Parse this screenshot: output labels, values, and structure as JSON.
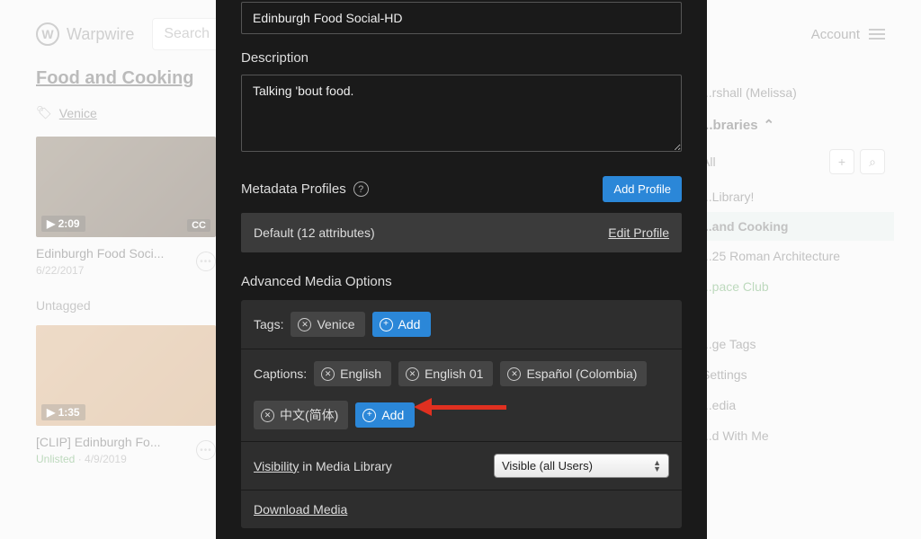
{
  "header": {
    "brand": "Warpwire",
    "search_placeholder": "Search",
    "account": "Account"
  },
  "library": {
    "title": "Food and Cooking",
    "tag": "Venice",
    "untagged_label": "Untagged",
    "cards": [
      {
        "duration": "▶ 2:09",
        "cc": "CC",
        "title": "Edinburgh Food Soci...",
        "date": "6/22/2017"
      },
      {
        "duration": "▶ 1:35",
        "title": "[CLIP] Edinburgh Fo...",
        "status": "Unlisted",
        "date": "4/9/2019"
      }
    ]
  },
  "sidebar": {
    "owner": "...rshall (Melissa)",
    "libraries_header": "...braries",
    "items": {
      "all": "All",
      "mylib": "...Library!",
      "active": "...and Cooking",
      "arch": "...25 Roman Architecture",
      "club": "...pace Club",
      "tags": "...ge Tags",
      "settings": "Settings",
      "media": "...edia",
      "shared": "...d With Me"
    }
  },
  "modal": {
    "title_value": "Edinburgh Food Social-HD",
    "description_label": "Description",
    "description_value": "Talking 'bout food.",
    "metadata_label": "Metadata Profiles",
    "add_profile": "Add Profile",
    "default_profile": "Default (12 attributes)",
    "edit_profile": "Edit Profile",
    "advanced_label": "Advanced Media Options",
    "tags_label": "Tags:",
    "tags": [
      "Venice"
    ],
    "add_label": "Add",
    "captions_label": "Captions:",
    "captions": [
      "English",
      "English 01",
      "Español (Colombia)",
      "中文(简体)"
    ],
    "visibility_u": "Visibility",
    "visibility_rest": " in Media Library",
    "visibility_value": "Visible (all Users)",
    "download": "Download Media"
  }
}
